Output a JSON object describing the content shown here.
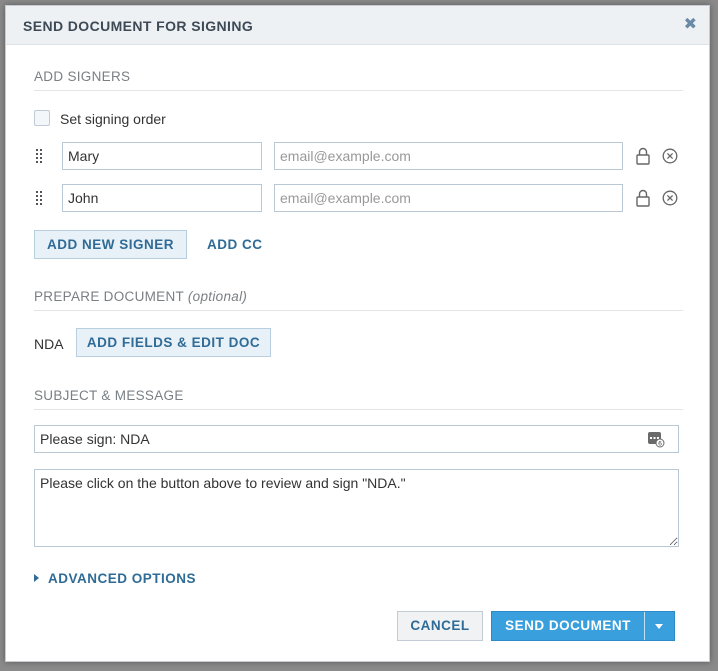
{
  "dialog": {
    "title": "SEND DOCUMENT FOR SIGNING",
    "close_icon": "close-icon"
  },
  "signers_section": {
    "label": "ADD SIGNERS",
    "signing_order_label": "Set signing order",
    "signing_order_checked": false,
    "signers": [
      {
        "name": "Mary",
        "email": "",
        "email_placeholder": "email@example.com"
      },
      {
        "name": "John",
        "email": "",
        "email_placeholder": "email@example.com"
      }
    ],
    "add_signer_label": "ADD NEW SIGNER",
    "add_cc_label": "ADD CC"
  },
  "prepare_section": {
    "label": "PREPARE DOCUMENT",
    "label_suffix": "(optional)",
    "document_name": "NDA",
    "edit_button_label": "ADD FIELDS & EDIT DOC"
  },
  "message_section": {
    "label": "SUBJECT & MESSAGE",
    "subject_value": "Please sign: NDA",
    "message_value": "Please click on the button above to review and sign \"NDA.\""
  },
  "advanced_options_label": "ADVANCED OPTIONS",
  "footer": {
    "cancel_label": "CANCEL",
    "send_label": "SEND DOCUMENT"
  },
  "colors": {
    "accent": "#3a9fdd",
    "link": "#2f6b96",
    "titlebar_bg": "#eef1f4"
  }
}
